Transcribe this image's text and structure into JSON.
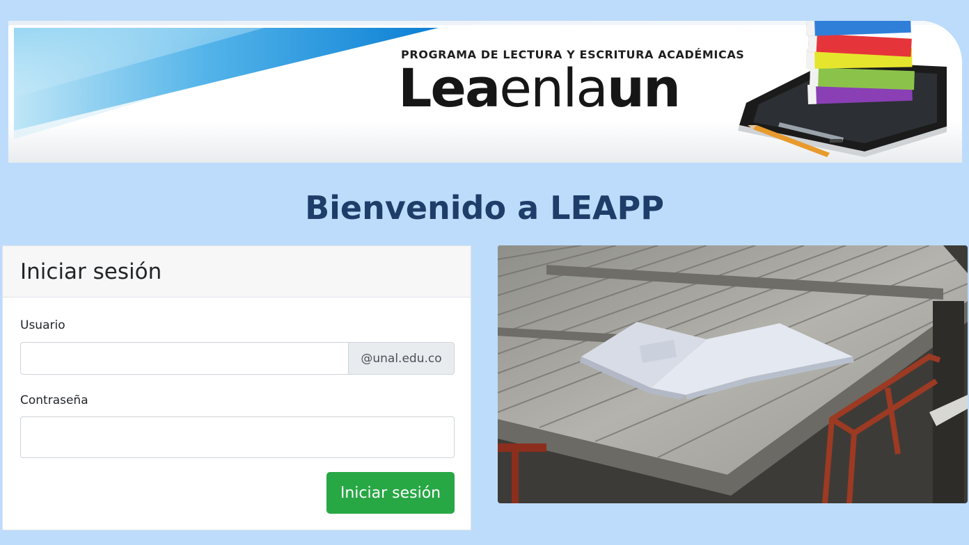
{
  "banner": {
    "program_name": "PROGRAMA DE LECTURA Y ESCRITURA ACADÉMICAS",
    "logo_part1": "Lea",
    "logo_part2": "enla",
    "logo_part3": "un"
  },
  "page": {
    "welcome_title": "Bienvenido a LEAPP"
  },
  "login": {
    "title": "Iniciar sesión",
    "username_label": "Usuario",
    "username_value": "",
    "email_domain": "@unal.edu.co",
    "password_label": "Contraseña",
    "password_value": "",
    "submit_label": "Iniciar sesión"
  },
  "colors": {
    "background": "#bddcfb",
    "title": "#1e3d68",
    "submit": "#28a745"
  }
}
